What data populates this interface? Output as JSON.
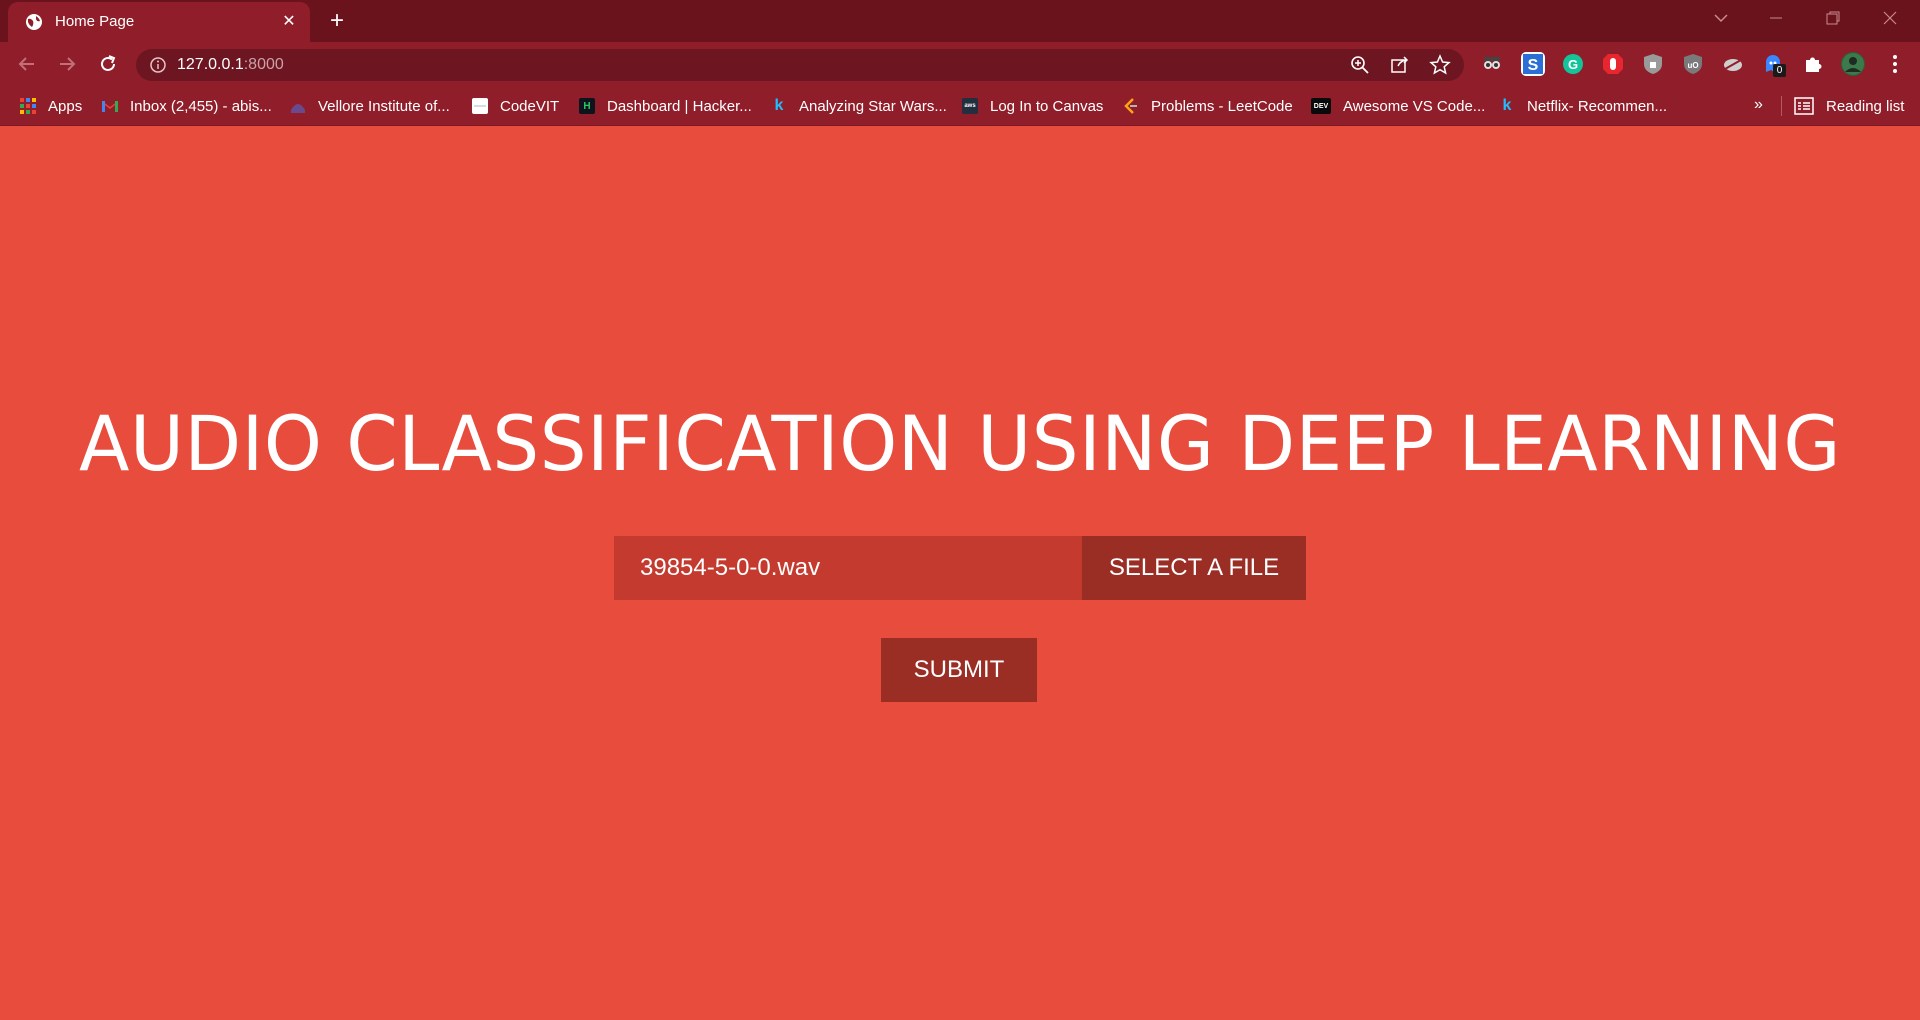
{
  "browser": {
    "tab": {
      "title": "Home Page"
    },
    "url": {
      "host": "127.0.0.1",
      "port": ":8000"
    },
    "bookmarks": [
      {
        "label": "Apps",
        "icon": "apps-grid-icon"
      },
      {
        "label": "Inbox (2,455) - abis...",
        "icon": "gmail-icon"
      },
      {
        "label": "Vellore Institute of...",
        "icon": "vit-icon"
      },
      {
        "label": "CodeVIT",
        "icon": "codevit-icon"
      },
      {
        "label": "Dashboard | Hacker...",
        "icon": "hackerrank-icon"
      },
      {
        "label": "Analyzing Star Wars...",
        "icon": "kaggle-icon"
      },
      {
        "label": "Log In to Canvas",
        "icon": "aws-icon"
      },
      {
        "label": "Problems - LeetCode",
        "icon": "leetcode-icon"
      },
      {
        "label": "Awesome VS Code...",
        "icon": "dev-icon"
      },
      {
        "label": "Netflix- Recommen...",
        "icon": "kaggle-icon"
      }
    ],
    "bookmarks_more": "»",
    "reading_list": "Reading list",
    "extension_badge": "0"
  },
  "page": {
    "headline": "AUDIO CLASSIFICATION USING DEEP LEARNING",
    "file_name": "39854-5-0-0.wav",
    "select_button": "SELECT A FILE",
    "submit_button": "SUBMIT"
  },
  "colors": {
    "page_bg": "#e84c3d",
    "file_field_bg": "#c43a2e",
    "button_bg": "#9a2d24",
    "chrome_dark": "#6b131c",
    "chrome_toolbar": "#8f1e2a"
  }
}
